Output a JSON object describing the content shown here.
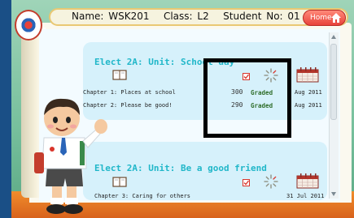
{
  "header": {
    "name_label": "Name: WSK201",
    "class_label": "Class: L2",
    "student_no_label": "Student No: 01",
    "home_label": "Home"
  },
  "units": [
    {
      "title": "Elect 2A: Unit: School day",
      "chapters": [
        {
          "label": "Chapter 1: Places at school",
          "score": "300",
          "status": "Graded",
          "date": "Aug 2011"
        },
        {
          "label": "Chapter 2: Please be good!",
          "score": "290",
          "status": "Graded",
          "date": "Aug 2011"
        }
      ]
    },
    {
      "title": "Elect 2A: Unit: Be a good friend",
      "chapters": [
        {
          "label": "Chapter 3: Caring for others",
          "date": "31 Jul 2011"
        }
      ]
    }
  ],
  "colors": {
    "accent_title": "#21b7c9",
    "card_bg": "#d6f1fb",
    "home_button": "#e8433a"
  },
  "icons": [
    "book-icon",
    "checkbox-icon",
    "loading-spinner-icon",
    "calendar-icon",
    "home-icon"
  ]
}
